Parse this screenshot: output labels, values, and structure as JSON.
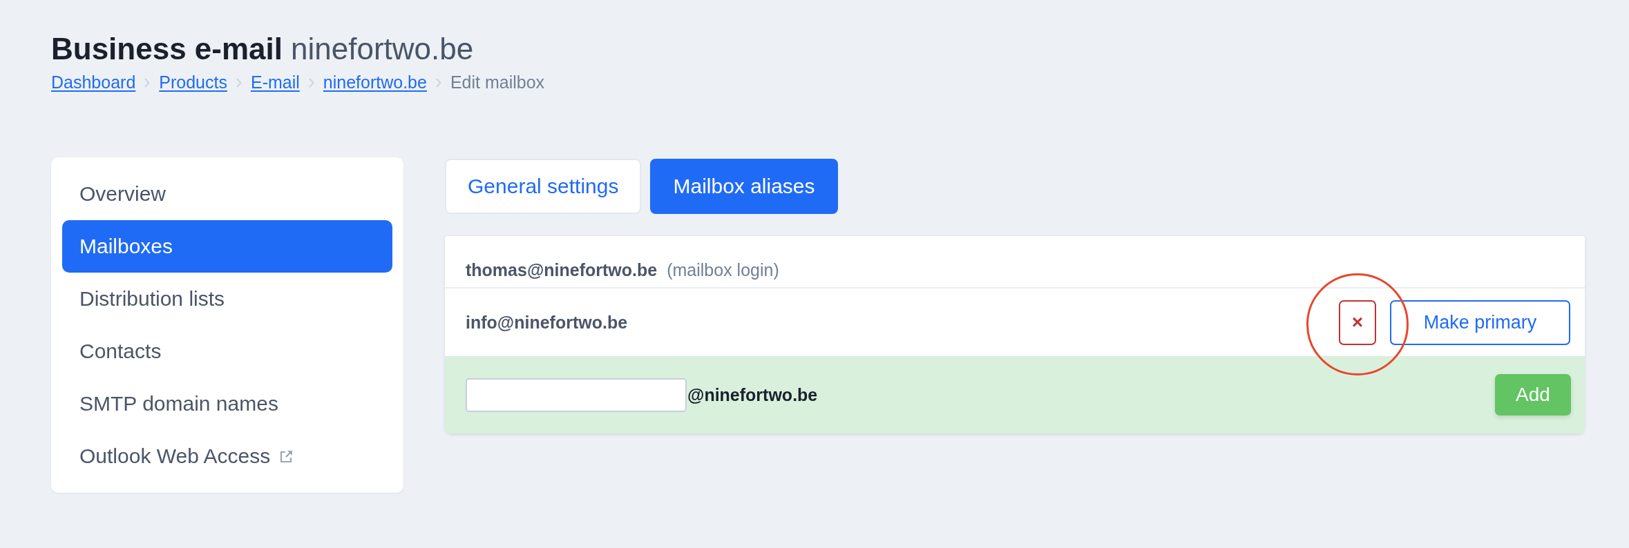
{
  "header": {
    "title": "Business e-mail",
    "domain": "ninefortwo.be"
  },
  "breadcrumb": [
    {
      "label": "Dashboard",
      "kind": "link"
    },
    {
      "label": "Products",
      "kind": "link"
    },
    {
      "label": "E-mail",
      "kind": "link"
    },
    {
      "label": "ninefortwo.be",
      "kind": "link"
    },
    {
      "label": "Edit mailbox",
      "kind": "current"
    }
  ],
  "sidebar": {
    "items": [
      {
        "label": "Overview",
        "selected": false,
        "external": false
      },
      {
        "label": "Mailboxes",
        "selected": true,
        "external": false
      },
      {
        "label": "Distribution lists",
        "selected": false,
        "external": false
      },
      {
        "label": "Contacts",
        "selected": false,
        "external": false
      },
      {
        "label": "SMTP domain names",
        "selected": false,
        "external": false
      },
      {
        "label": "Outlook Web Access",
        "selected": false,
        "external": true
      }
    ]
  },
  "tabs": [
    {
      "label": "General settings",
      "selected": false
    },
    {
      "label": "Mailbox aliases",
      "selected": true
    }
  ],
  "aliases": [
    {
      "kind": "login",
      "address": "thomas@ninefortwo.be",
      "note": "(mailbox login)"
    },
    {
      "kind": "alias",
      "address": "info@ninefortwo.be",
      "remove_label": "×",
      "remove_highlighted": true,
      "make_primary_label": "Make primary"
    }
  ],
  "add_alias": {
    "suffix": "@ninefortwo.be",
    "button": "Add"
  }
}
